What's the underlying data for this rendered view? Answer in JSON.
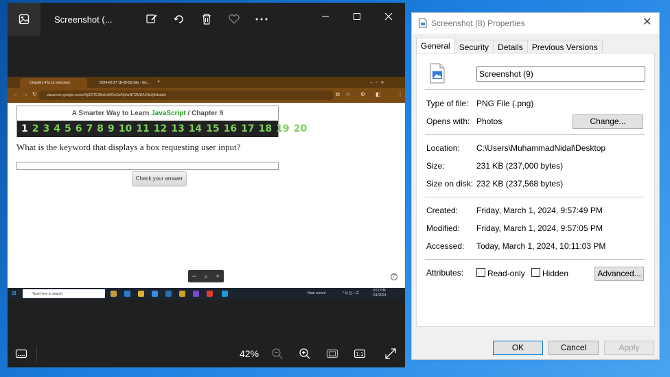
{
  "photos": {
    "title": "Screenshot (...",
    "zoom_level": "42%",
    "icons": [
      "photo-app-icon",
      "edit-icon",
      "rotate-icon",
      "delete-icon",
      "favorite-icon",
      "more-icon",
      "minimize-icon",
      "maximize-icon",
      "close-icon"
    ],
    "bottom_icons": [
      "filmstrip-icon",
      "zoom-out-icon",
      "zoom-in-icon",
      "fit-icon",
      "actual-size-icon",
      "fullscreen-icon"
    ]
  },
  "browser": {
    "tabs": [
      {
        "label": "Chapters 4 to 11 exercises"
      },
      {
        "label": "2024-02-27 18-39-53.mkv - Go..."
      }
    ],
    "new_tab": "+",
    "url": "classroom.google.com/c/NjI2OTE3MzUxMDc2/a/NjUwNTI2MDA1NzQ0/details"
  },
  "quiz": {
    "title_prefix": "A Smarter Way to Learn ",
    "title_js": "JavaScript",
    "title_suffix": " / Chapter 9",
    "numbers": [
      "1",
      "2",
      "3",
      "4",
      "5",
      "6",
      "7",
      "8",
      "9",
      "10",
      "11",
      "12",
      "13",
      "14",
      "15",
      "16",
      "17",
      "18",
      "19",
      "20"
    ],
    "current": "1",
    "question": "What is the keyword that displays a box requesting user input?",
    "button": "Check your answer",
    "zoom_minus": "−",
    "zoom_icon": "⌕",
    "zoom_plus": "+",
    "help": "?"
  },
  "taskbar": {
    "search_placeholder": "Type here to search",
    "weather": "Near record",
    "time": "9:57 PM",
    "date": "3/1/2024"
  },
  "properties": {
    "title": "Screenshot (8) Properties",
    "close": "✕",
    "tabs": [
      "General",
      "Security",
      "Details",
      "Previous Versions"
    ],
    "file_name": "Screenshot (9)",
    "type_label": "Type of file:",
    "type_value": "PNG File (.png)",
    "opens_label": "Opens with:",
    "opens_value": "Photos",
    "change_button": "Change...",
    "location_label": "Location:",
    "location_value": "C:\\Users\\MuhammadNidal\\Desktop",
    "size_label": "Size:",
    "size_value": "231 KB (237,000 bytes)",
    "size_disk_label": "Size on disk:",
    "size_disk_value": "232 KB (237,568 bytes)",
    "created_label": "Created:",
    "created_value": "Friday, March 1, 2024, 9:57:49 PM",
    "modified_label": "Modified:",
    "modified_value": "Friday, March 1, 2024, 9:57:05 PM",
    "accessed_label": "Accessed:",
    "accessed_value": "Today, March 1, 2024, 10:11:03 PM",
    "attributes_label": "Attributes:",
    "readonly_label": "Read-only",
    "hidden_label": "Hidden",
    "advanced_button": "Advanced...",
    "ok_button": "OK",
    "cancel_button": "Cancel",
    "apply_button": "Apply"
  }
}
